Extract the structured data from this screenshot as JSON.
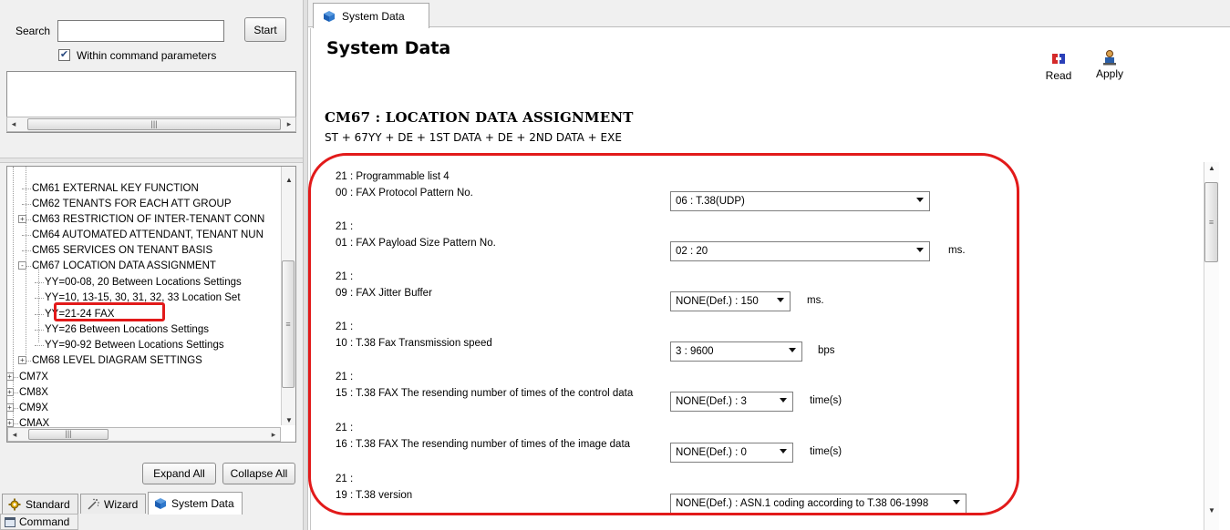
{
  "left_panel": {
    "search": {
      "label": "Search",
      "value": "",
      "start_button": "Start",
      "within_checked": true,
      "within_label": "Within command parameters"
    },
    "tree": [
      {
        "label": "CM61 EXTERNAL KEY FUNCTION",
        "expander": ""
      },
      {
        "label": "CM62 TENANTS FOR EACH ATT GROUP",
        "expander": ""
      },
      {
        "label": "CM63 RESTRICTION OF INTER-TENANT CONN",
        "expander": "+"
      },
      {
        "label": "CM64 AUTOMATED ATTENDANT, TENANT NUN",
        "expander": ""
      },
      {
        "label": "CM65 SERVICES ON TENANT BASIS",
        "expander": ""
      },
      {
        "label": "CM67 LOCATION DATA ASSIGNMENT",
        "expander": "-"
      },
      {
        "label": "YY=00-08, 20 Between Locations Settings",
        "expander": ""
      },
      {
        "label": "YY=10, 13-15, 30, 31, 32, 33 Location Set",
        "expander": ""
      },
      {
        "label": "YY=21-24 FAX",
        "expander": ""
      },
      {
        "label": "YY=26 Between Locations Settings",
        "expander": ""
      },
      {
        "label": "YY=90-92 Between Locations Settings",
        "expander": ""
      },
      {
        "label": "CM68 LEVEL DIAGRAM SETTINGS",
        "expander": "+"
      },
      {
        "label": "CM7X",
        "expander": "+"
      },
      {
        "label": "CM8X",
        "expander": "+"
      },
      {
        "label": "CM9X",
        "expander": "+"
      },
      {
        "label": "CMAX",
        "expander": "+"
      }
    ],
    "expand_all": "Expand All",
    "collapse_all": "Collapse All",
    "tabs": [
      "Standard",
      "Wizard",
      "System Data"
    ],
    "active_tab": "System Data",
    "command_label": "Command"
  },
  "right_panel": {
    "tab_label": "System Data",
    "title": "System Data",
    "toolbar": {
      "read": "Read",
      "apply": "Apply"
    },
    "command_title": "CM67 : LOCATION DATA ASSIGNMENT",
    "command_formula": "ST + 67YY + DE + 1ST DATA + DE + 2ND DATA + EXE",
    "params": [
      {
        "header": "21 : Programmable list 4",
        "label": "00 : FAX Protocol Pattern No.",
        "value": "06 : T.38(UDP)",
        "unit": ""
      },
      {
        "header": "21 :",
        "label": "01 : FAX Payload Size Pattern No.",
        "value": "02 :  20",
        "unit": "ms."
      },
      {
        "header": "21 :",
        "label": "09 : FAX Jitter Buffer",
        "value": "NONE(Def.) : 150",
        "unit": "ms."
      },
      {
        "header": "21 :",
        "label": "10 : T.38 Fax Transmission speed",
        "value": "3 : 9600",
        "unit": "bps"
      },
      {
        "header": "21 :",
        "label": "15 : T.38 FAX  The resending number of times of the control data",
        "value": "NONE(Def.) : 3",
        "unit": "time(s)"
      },
      {
        "header": "21 :",
        "label": "16 : T.38 FAX  The resending number of times of the image data",
        "value": "NONE(Def.) : 0",
        "unit": "time(s)"
      },
      {
        "header": "21 :",
        "label": "19 : T.38 version",
        "value": "NONE(Def.) : ASN.1 coding according to T.38 06-1998",
        "unit": ""
      }
    ]
  },
  "colors": {
    "annotation_red": "#e21a1a",
    "read_icon": "#d42a2a",
    "apply_icon": "#2b5fa8"
  }
}
